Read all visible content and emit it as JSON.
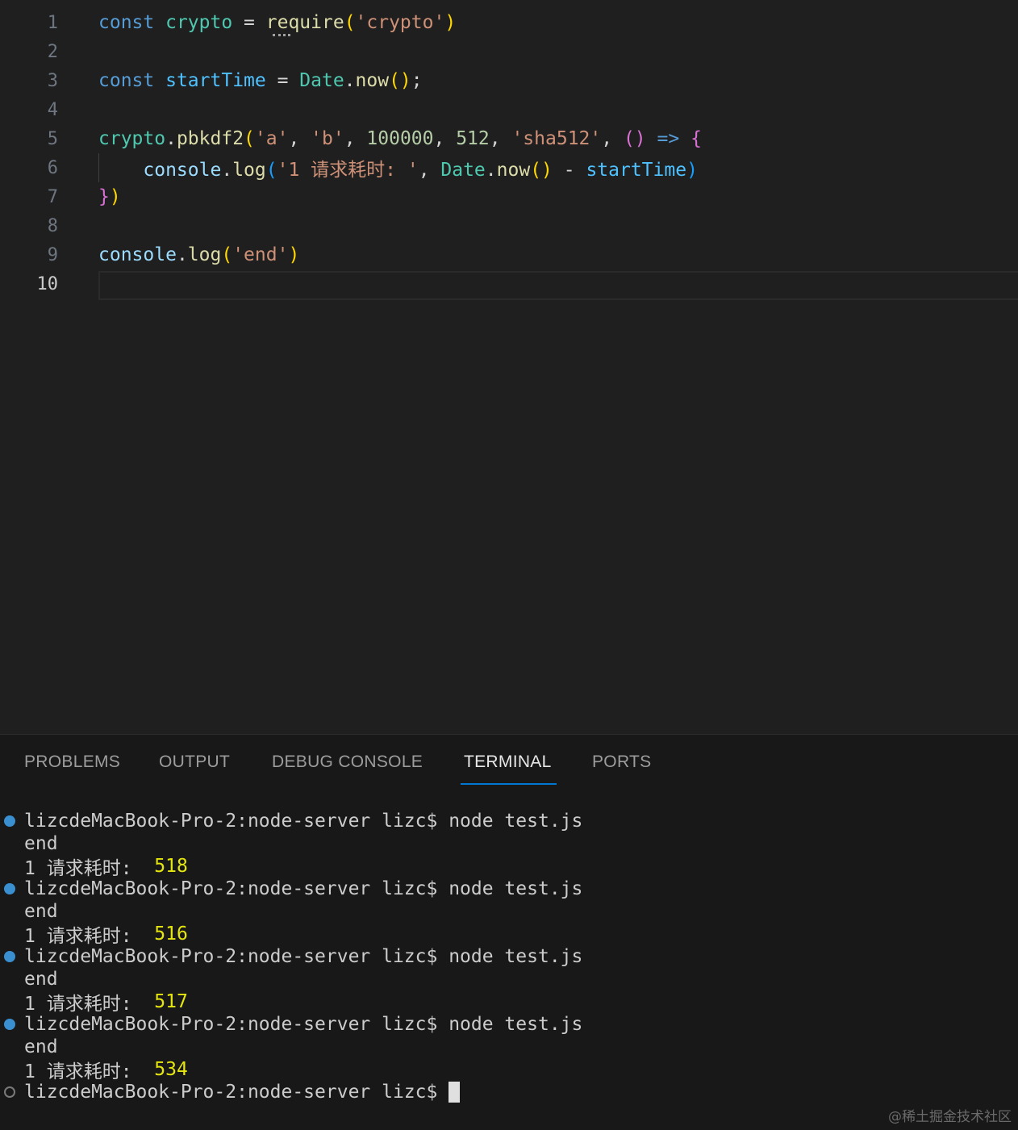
{
  "editor": {
    "lines": [
      {
        "n": "1",
        "tokens": [
          [
            "kw",
            "const"
          ],
          [
            "punc",
            " "
          ],
          [
            "cls",
            "crypto"
          ],
          [
            "punc",
            " = "
          ],
          [
            "fn",
            "require"
          ],
          [
            "p1",
            "("
          ],
          [
            "str",
            "'crypto'"
          ],
          [
            "p1",
            ")"
          ]
        ]
      },
      {
        "n": "2",
        "tokens": []
      },
      {
        "n": "3",
        "tokens": [
          [
            "kw",
            "const"
          ],
          [
            "punc",
            " "
          ],
          [
            "var",
            "startTime"
          ],
          [
            "punc",
            " = "
          ],
          [
            "cls",
            "Date"
          ],
          [
            "punc",
            "."
          ],
          [
            "fn",
            "now"
          ],
          [
            "p1",
            "()"
          ],
          [
            "punc",
            ";"
          ]
        ]
      },
      {
        "n": "4",
        "tokens": []
      },
      {
        "n": "5",
        "tokens": [
          [
            "cls",
            "crypto"
          ],
          [
            "punc",
            "."
          ],
          [
            "fn",
            "pbkdf2"
          ],
          [
            "p1",
            "("
          ],
          [
            "str",
            "'a'"
          ],
          [
            "punc",
            ", "
          ],
          [
            "str",
            "'b'"
          ],
          [
            "punc",
            ", "
          ],
          [
            "num",
            "100000"
          ],
          [
            "punc",
            ", "
          ],
          [
            "num",
            "512"
          ],
          [
            "punc",
            ", "
          ],
          [
            "str",
            "'sha512'"
          ],
          [
            "punc",
            ", "
          ],
          [
            "p2",
            "()"
          ],
          [
            "punc",
            " "
          ],
          [
            "kw",
            "=>"
          ],
          [
            "punc",
            " "
          ],
          [
            "p2",
            "{"
          ]
        ]
      },
      {
        "n": "6",
        "tokens": [
          [
            "punc",
            "    "
          ],
          [
            "obj",
            "console"
          ],
          [
            "punc",
            "."
          ],
          [
            "fn",
            "log"
          ],
          [
            "p3",
            "("
          ],
          [
            "str",
            "'1 请求耗时: '"
          ],
          [
            "punc",
            ", "
          ],
          [
            "cls",
            "Date"
          ],
          [
            "punc",
            "."
          ],
          [
            "fn",
            "now"
          ],
          [
            "p1",
            "()"
          ],
          [
            "punc",
            " - "
          ],
          [
            "var",
            "startTime"
          ],
          [
            "p3",
            ")"
          ]
        ]
      },
      {
        "n": "7",
        "tokens": [
          [
            "p2",
            "}"
          ],
          [
            "p1",
            ")"
          ]
        ]
      },
      {
        "n": "8",
        "tokens": []
      },
      {
        "n": "9",
        "tokens": [
          [
            "obj",
            "console"
          ],
          [
            "punc",
            "."
          ],
          [
            "fn",
            "log"
          ],
          [
            "p1",
            "("
          ],
          [
            "str",
            "'end'"
          ],
          [
            "p1",
            ")"
          ]
        ]
      },
      {
        "n": "10",
        "tokens": []
      }
    ],
    "active_line": "10"
  },
  "panel": {
    "tabs": [
      "PROBLEMS",
      "OUTPUT",
      "DEBUG CONSOLE",
      "TERMINAL",
      "PORTS"
    ],
    "active_tab": "TERMINAL"
  },
  "terminal": {
    "prompt": "lizcdeMacBook-Pro-2:node-server lizc$ ",
    "command": "node test.js",
    "runs": [
      {
        "out1": "end",
        "label": "1 请求耗时: ",
        "time": "518"
      },
      {
        "out1": "end",
        "label": "1 请求耗时: ",
        "time": "516"
      },
      {
        "out1": "end",
        "label": "1 请求耗时: ",
        "time": "517"
      },
      {
        "out1": "end",
        "label": "1 请求耗时: ",
        "time": "534"
      }
    ],
    "final_prompt": "lizcdeMacBook-Pro-2:node-server lizc$"
  },
  "watermark": "@稀土掘金技术社区",
  "colors": {
    "accent": "#0078d4",
    "dot": "#3a8fd0",
    "highlight": "#e5e510"
  }
}
